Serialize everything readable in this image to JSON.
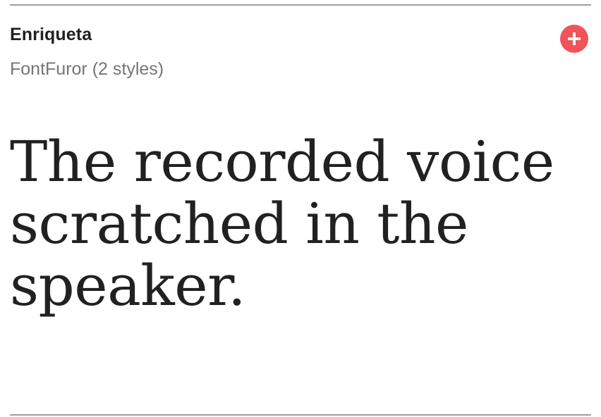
{
  "font": {
    "name": "Enriqueta",
    "foundry_styles": "FontFuror (2 styles)"
  },
  "sample_text": "The recorded voice scratched in the speaker.",
  "actions": {
    "add_icon": "plus-icon"
  },
  "colors": {
    "accent": "#f05459",
    "name_text": "#212121",
    "meta_text": "#757575",
    "divider": "#9e9e9e"
  }
}
